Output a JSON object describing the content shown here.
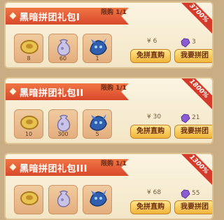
{
  "packs": [
    {
      "title": "黑暗拼团礼包I",
      "limit": "限购 1/1",
      "ribbon": "3700%",
      "items": [
        {
          "icon": "coin-ring-icon",
          "count": "8"
        },
        {
          "icon": "pouch-icon",
          "count": "60"
        },
        {
          "icon": "blue-creature-icon",
          "count": "1"
        }
      ],
      "price": "¥ 6",
      "gems": "3",
      "buy_label": "免拼直购",
      "join_label": "我要拼团"
    },
    {
      "title": "黑暗拼团礼包II",
      "limit": "限购 1/1",
      "ribbon": "1800%",
      "items": [
        {
          "icon": "coin-ring-icon",
          "count": "10"
        },
        {
          "icon": "pouch-icon",
          "count": "300"
        },
        {
          "icon": "blue-creature-icon",
          "count": "5"
        }
      ],
      "price": "¥ 30",
      "gems": "21",
      "buy_label": "免拼直购",
      "join_label": "我要拼团"
    },
    {
      "title": "黑暗拼团礼包III",
      "limit": "限购 1/1",
      "ribbon": "1300%",
      "items": [
        {
          "icon": "coin-ring-icon",
          "count": ""
        },
        {
          "icon": "pouch-icon",
          "count": ""
        },
        {
          "icon": "blue-creature-icon",
          "count": ""
        }
      ],
      "price": "¥ 68",
      "gems": "55",
      "buy_label": "免拼直购",
      "join_label": "我要拼团"
    }
  ],
  "colors": {
    "banner": "#e05a34",
    "button": "#f6c84f",
    "ribbon": "#d43b2a",
    "gem": "#8a5cd6"
  }
}
